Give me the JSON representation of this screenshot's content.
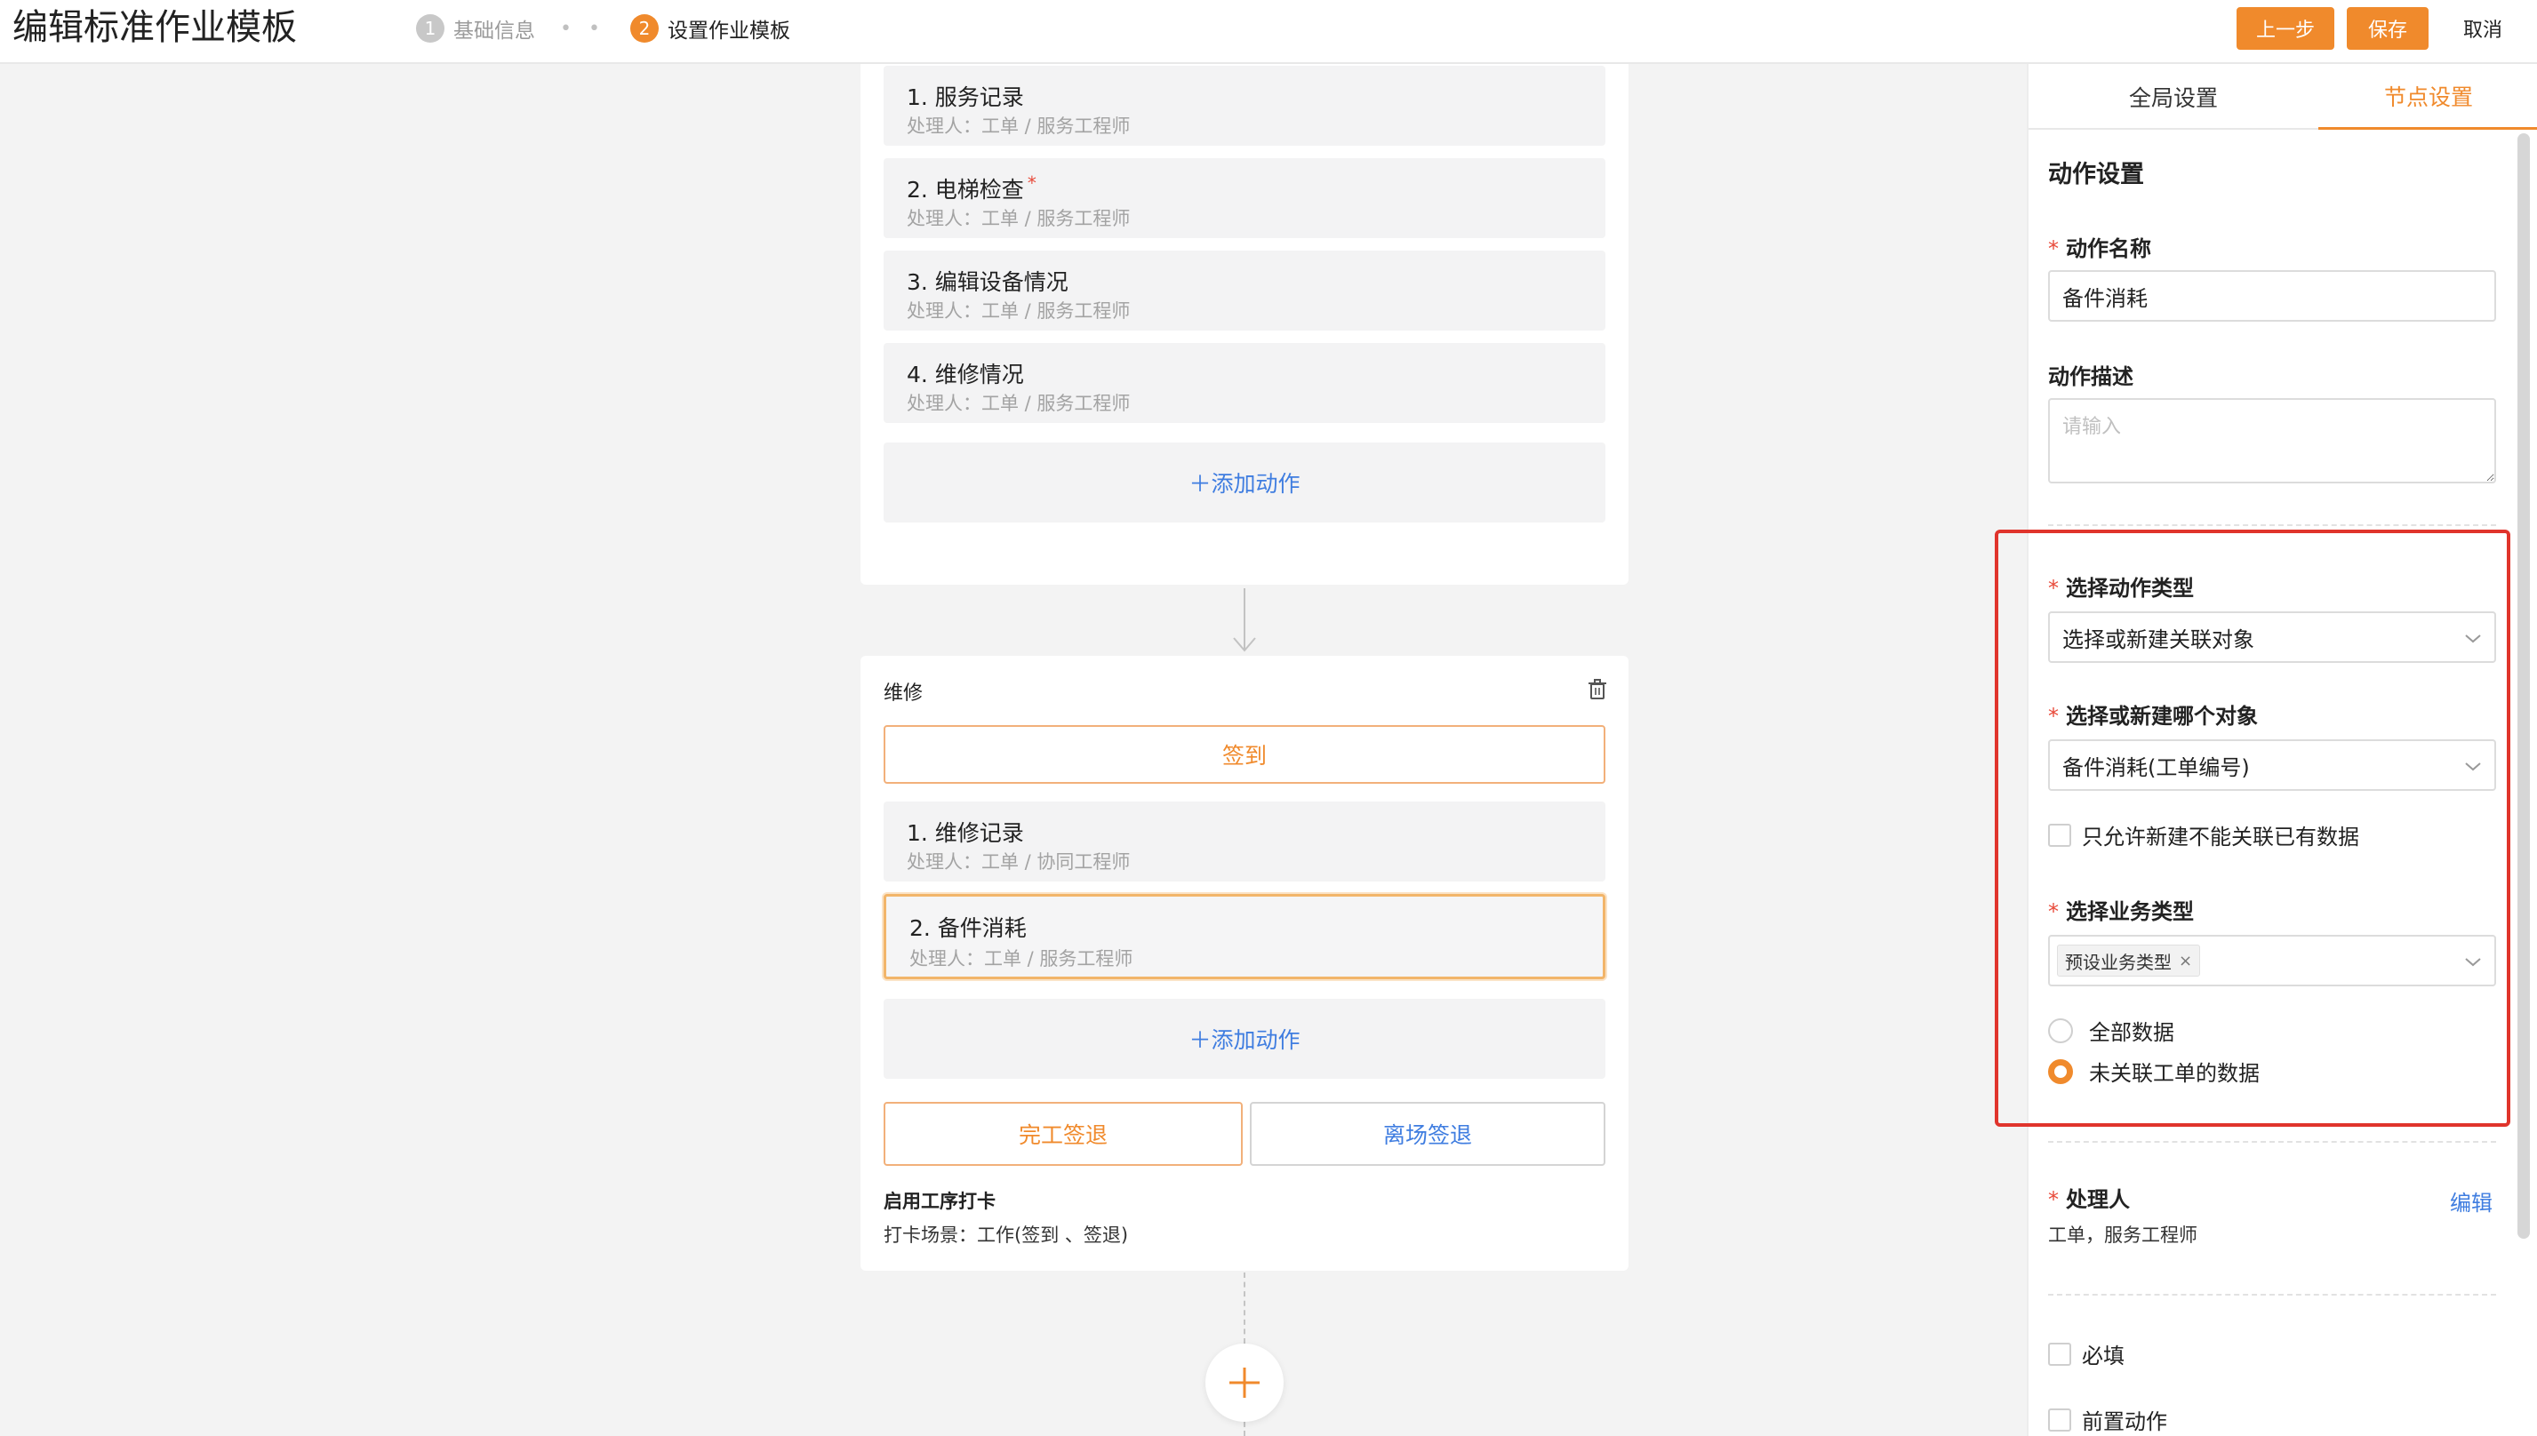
{
  "header": {
    "title": "编辑标准作业模板",
    "steps": [
      {
        "num": "1",
        "label": "基础信息"
      },
      {
        "num": "2",
        "label": "设置作业模板"
      }
    ],
    "step_separator": "• •",
    "buttons": {
      "prev": "上一步",
      "save": "保存",
      "cancel": "取消"
    }
  },
  "stage1": {
    "actions": [
      {
        "title": "1. 服务记录",
        "sub": "处理人：工单 / 服务工程师"
      },
      {
        "title": "2. 电梯检查",
        "sub": "处理人：工单 / 服务工程师",
        "required_mark": "*"
      },
      {
        "title": "3. 编辑设备情况",
        "sub": "处理人：工单 / 服务工程师"
      },
      {
        "title": "4. 维修情况",
        "sub": "处理人：工单 / 服务工程师"
      }
    ],
    "add_action": "＋添加动作"
  },
  "stage2": {
    "title": "维修",
    "sign_in": "签到",
    "actions": [
      {
        "title": "1. 维修记录",
        "sub": "处理人：工单 / 协同工程师"
      },
      {
        "title": "2. 备件消耗",
        "sub": "处理人：工单 / 服务工程师"
      }
    ],
    "add_action": "＋添加动作",
    "finish_out": "完工签退",
    "leave_out": "离场签退",
    "punch_title": "启用工序打卡",
    "punch_scene": "打卡场景：工作(签到 、签退)"
  },
  "panel": {
    "tabs": {
      "global": "全局设置",
      "node": "节点设置"
    },
    "section_title": "动作设置",
    "action_name": {
      "label": "动作名称",
      "value": "备件消耗"
    },
    "action_desc": {
      "label": "动作描述",
      "placeholder": "请输入"
    },
    "action_type": {
      "label": "选择动作类型",
      "value": "选择或新建关联对象"
    },
    "which_object": {
      "label": "选择或新建哪个对象",
      "value": "备件消耗(工单编号)"
    },
    "only_new": "只允许新建不能关联已有数据",
    "biz_type": {
      "label": "选择业务类型",
      "tag": "预设业务类型",
      "tag_close": "×"
    },
    "radios": {
      "all": "全部数据",
      "unlinked": "未关联工单的数据"
    },
    "handler": {
      "label": "处理人",
      "edit": "编辑",
      "value": "工单，服务工程师"
    },
    "required": "必填",
    "pre_action": "前置动作"
  },
  "colors": {
    "accent": "#f08a2c",
    "link": "#3f7de0",
    "highlight": "#e0342c"
  }
}
